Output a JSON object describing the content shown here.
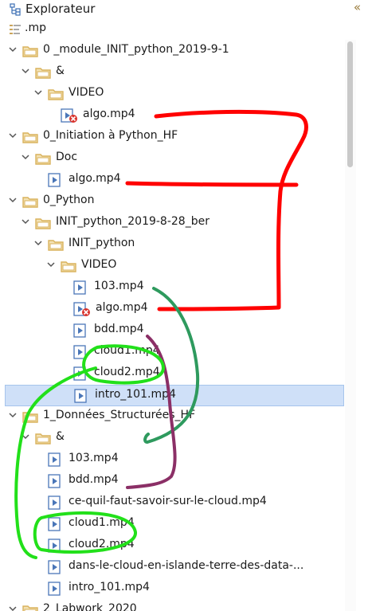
{
  "panel": {
    "title": "Explorateur",
    "collapse_glyph": "«"
  },
  "filter": {
    "text": ".mp"
  },
  "tree": [
    {
      "label": "0 _module_INIT_python_2019-9-1",
      "type": "folder",
      "depth": 0,
      "expanded": true
    },
    {
      "label": "&",
      "type": "folder",
      "depth": 1,
      "expanded": true
    },
    {
      "label": "VIDEO",
      "type": "folder",
      "depth": 2,
      "expanded": true
    },
    {
      "label": "algo.mp4",
      "type": "file",
      "depth": 3,
      "error": true
    },
    {
      "label": "0_Initiation à Python_HF",
      "type": "folder",
      "depth": 0,
      "expanded": true
    },
    {
      "label": "Doc",
      "type": "folder",
      "depth": 1,
      "expanded": true
    },
    {
      "label": "algo.mp4",
      "type": "file",
      "depth": 2,
      "error": false
    },
    {
      "label": "0_Python",
      "type": "folder",
      "depth": 0,
      "expanded": true
    },
    {
      "label": "INIT_python_2019-8-28_ber",
      "type": "folder",
      "depth": 1,
      "expanded": true
    },
    {
      "label": "INIT_python",
      "type": "folder",
      "depth": 2,
      "expanded": true
    },
    {
      "label": "VIDEO",
      "type": "folder",
      "depth": 3,
      "expanded": true
    },
    {
      "label": "103.mp4",
      "type": "file",
      "depth": 4,
      "error": false
    },
    {
      "label": "algo.mp4",
      "type": "file",
      "depth": 4,
      "error": true
    },
    {
      "label": "bdd.mp4",
      "type": "file",
      "depth": 4,
      "error": false
    },
    {
      "label": "cloud1.mp4",
      "type": "file",
      "depth": 4,
      "error": false
    },
    {
      "label": "cloud2.mp4",
      "type": "file",
      "depth": 4,
      "error": false
    },
    {
      "label": "intro_101.mp4",
      "type": "file",
      "depth": 4,
      "error": false,
      "selected": true
    },
    {
      "label": "1_Données_Structurées_HF",
      "type": "folder",
      "depth": 0,
      "expanded": true
    },
    {
      "label": "&",
      "type": "folder",
      "depth": 1,
      "expanded": true
    },
    {
      "label": "103.mp4",
      "type": "file",
      "depth": 2,
      "error": false
    },
    {
      "label": "bdd.mp4",
      "type": "file",
      "depth": 2,
      "error": false
    },
    {
      "label": "ce-quil-faut-savoir-sur-le-cloud.mp4",
      "type": "file",
      "depth": 2,
      "error": false
    },
    {
      "label": "cloud1.mp4",
      "type": "file",
      "depth": 2,
      "error": false
    },
    {
      "label": "cloud2.mp4",
      "type": "file",
      "depth": 2,
      "error": false
    },
    {
      "label": "dans-le-cloud-en-islande-terre-des-data-...",
      "type": "file",
      "depth": 2,
      "error": false
    },
    {
      "label": "intro_101.mp4",
      "type": "file",
      "depth": 2,
      "error": false
    },
    {
      "label": "2_Labwork_2020",
      "type": "folder",
      "depth": 0,
      "expanded": true
    }
  ],
  "colors": {
    "folder": "#d9b25c",
    "file_icon": "#4a76b8",
    "error": "#d9322b",
    "selection": "#cfe0f8",
    "annotation_red": "#ff0000",
    "annotation_green": "#22e01a",
    "annotation_teal": "#2e9a5e",
    "annotation_purple": "#8b2f66"
  }
}
